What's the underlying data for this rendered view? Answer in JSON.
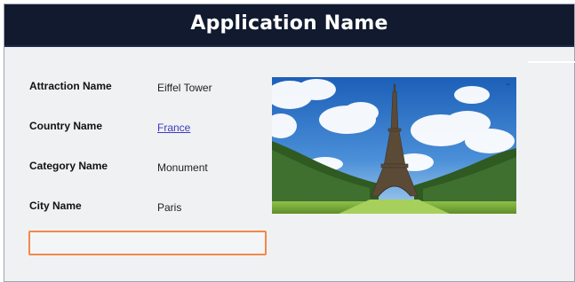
{
  "app": {
    "title": "Application Name"
  },
  "fields": [
    {
      "label": "Attraction Name",
      "value": "Eiffel Tower",
      "is_link": false
    },
    {
      "label": "Country Name",
      "value": "France",
      "is_link": true
    },
    {
      "label": "Category Name",
      "value": "Monument",
      "is_link": false
    },
    {
      "label": "City Name",
      "value": "Paris",
      "is_link": false
    }
  ],
  "image": {
    "subject": "eiffel-tower-photo"
  },
  "colors": {
    "header_bg": "#111a2e",
    "link": "#3b3bbd",
    "focus_border": "#ef8a4a"
  }
}
